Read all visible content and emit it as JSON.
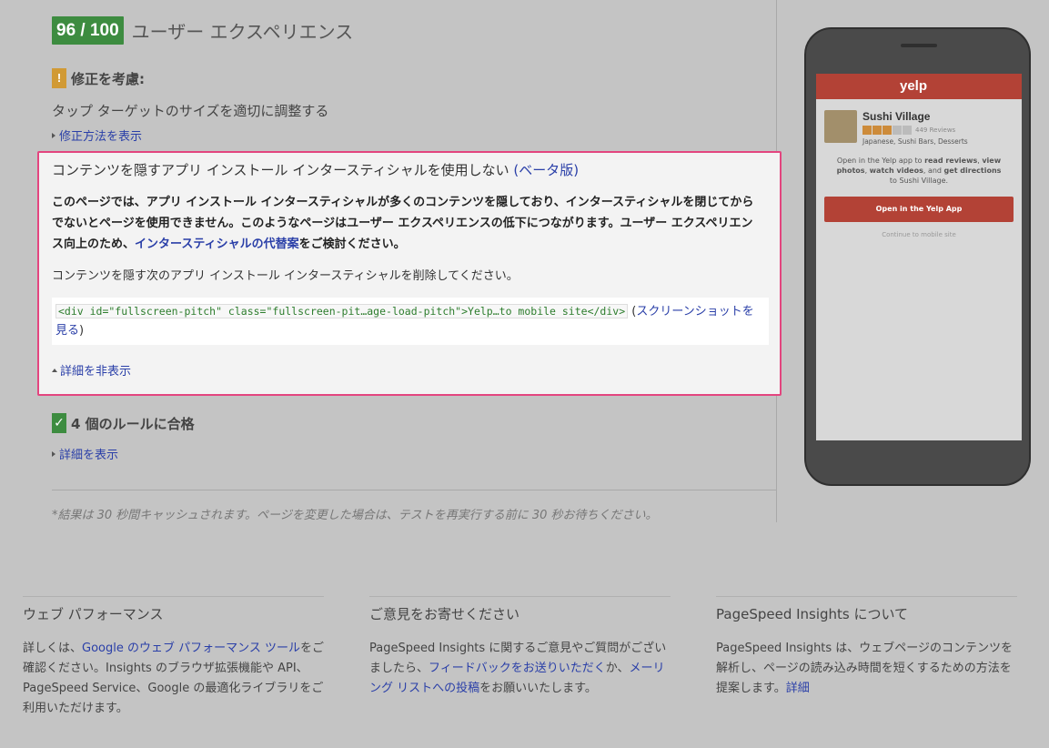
{
  "score": {
    "badge": "96 / 100",
    "title": "ユーザー エクスペリエンス"
  },
  "consider": {
    "icon": "!",
    "title": "修正を考慮:",
    "rule_name": "タップ ターゲットのサイズを適切に調整する",
    "show_fix_link": "修正方法を表示"
  },
  "panel": {
    "title": "コンテンツを隠すアプリ インストール インタースティシャルを使用しない",
    "beta_link": "(ベータ版)",
    "body_part1": "このページでは、アプリ インストール インタースティシャルが多くのコンテンツを隠しており、インタースティシャルを閉じてからでないとページを使用できません。このようなページはユーザー エクスペリエンスの低下につながります。ユーザー エクスペリエンス向上のため、",
    "body_link": "インタースティシャルの代替案",
    "body_part2": "をご検討ください。",
    "remove_text": "コンテンツを隠す次のアプリ インストール インタースティシャルを削除してください。",
    "code": "<div id=\"fullscreen-pitch\" class=\"fullscreen-pit…age-load-pitch\">Yelp…to mobile site</div>",
    "screenshot_open": "(",
    "screenshot_link": "スクリーンショットを見る",
    "screenshot_close": ")",
    "hide_details": "詳細を非表示"
  },
  "passed": {
    "icon": "✓",
    "title": "4 個のルールに合格",
    "show_details": "詳細を表示"
  },
  "cache_note": "*結果は 30 秒間キャッシュされます。ページを変更した場合は、テストを再実行する前に 30 秒お待ちください。",
  "phone": {
    "logo": "yelp",
    "biz_name": "Sushi Village",
    "reviews": "449 Reviews",
    "stars_filled": 3,
    "stars_total": 5,
    "categories": "Japanese, Sushi Bars, Desserts",
    "msg_1": "Open in the Yelp app to ",
    "msg_b1": "read reviews",
    "msg_2": ", ",
    "msg_b2": "view photos",
    "msg_3": ", ",
    "msg_b3": "watch videos",
    "msg_4": ", and ",
    "msg_b4": "get directions",
    "msg_5": " to Sushi Village.",
    "button": "Open in the Yelp App",
    "continue": "Continue to mobile site"
  },
  "footer": {
    "col1": {
      "title": "ウェブ パフォーマンス",
      "p1": "詳しくは、",
      "link": "Google のウェブ パフォーマンス ツール",
      "p2": "をご確認ください。Insights のブラウザ拡張機能や API、PageSpeed Service、Google の最適化ライブラリをご利用いただけます。"
    },
    "col2": {
      "title": "ご意見をお寄せください",
      "p1": "PageSpeed Insights に関するご意見やご質問がございましたら、",
      "link1": "フィードバックをお送りいただく",
      "p2": "か、",
      "link2": "メーリング リストへの投稿",
      "p3": "をお願いいたします。"
    },
    "col3": {
      "title": "PageSpeed Insights について",
      "p1": "PageSpeed Insights は、ウェブページのコンテンツを解析し、ページの読み込み時間を短くするための方法を提案します。",
      "link": "詳細"
    }
  }
}
